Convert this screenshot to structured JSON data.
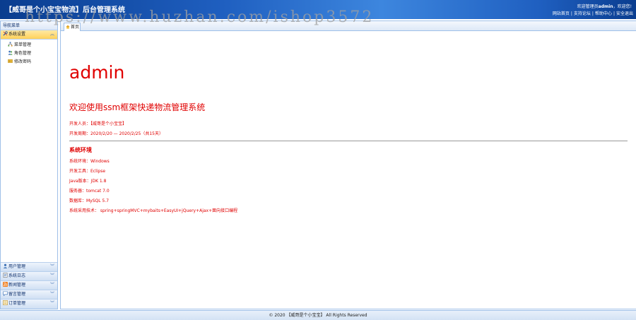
{
  "header": {
    "title": "【威哥是个小宝宝物流】后台管理系统",
    "welcome_prefix": "欢迎管理员",
    "welcome_user": "admin",
    "welcome_suffix": "，欢迎您!",
    "links": [
      "网站首页",
      "支持论坛",
      "帮助中心",
      "安全退出"
    ]
  },
  "watermark": "https://www.huzhan.com/ishop3572",
  "sidebar": {
    "nav_title": "导航菜单",
    "active_section": {
      "label": "系统设置",
      "icon": "tools-icon",
      "items": [
        {
          "label": "菜单管理",
          "icon": "sitemap-icon"
        },
        {
          "label": "角色管理",
          "icon": "users-icon"
        },
        {
          "label": "修改密码",
          "icon": "key-icon"
        }
      ]
    },
    "collapsed_sections": [
      {
        "label": "用户管理",
        "icon": "user-icon"
      },
      {
        "label": "系统日志",
        "icon": "log-icon"
      },
      {
        "label": "新闻管理",
        "icon": "rss-icon"
      },
      {
        "label": "留言管理",
        "icon": "comment-icon"
      },
      {
        "label": "订单管理",
        "icon": "order-icon"
      }
    ]
  },
  "tabs": {
    "home": "首页"
  },
  "main": {
    "title": "admin",
    "subtitle": "欢迎使用ssm框架快递物流管理系统",
    "developer": "开发人员：【威哥是个小宝宝】",
    "dev_period": "开发周期：2020/2/20 — 2020/2/25（共15天）",
    "env_heading": "系统环境",
    "env": {
      "os": "系统环境：Windows",
      "tool": "开发工具：Eclipse",
      "java": "Java版本：JDK 1.8",
      "server": "服务器：tomcat 7.0",
      "db": "数据库：MySQL 5.7",
      "tech": "系统采用技术： spring+springMVC+mybaits+EasyUI+jQuery+Ajax+面向接口编程"
    }
  },
  "footer": "© 2020 【威哥是个小宝宝】 All Rights Reserved",
  "colors": {
    "accent_red": "#e00000",
    "header_blue": "#1f5fc0",
    "border_blue": "#9fc0e8",
    "active_yellow": "#ffd15a"
  }
}
